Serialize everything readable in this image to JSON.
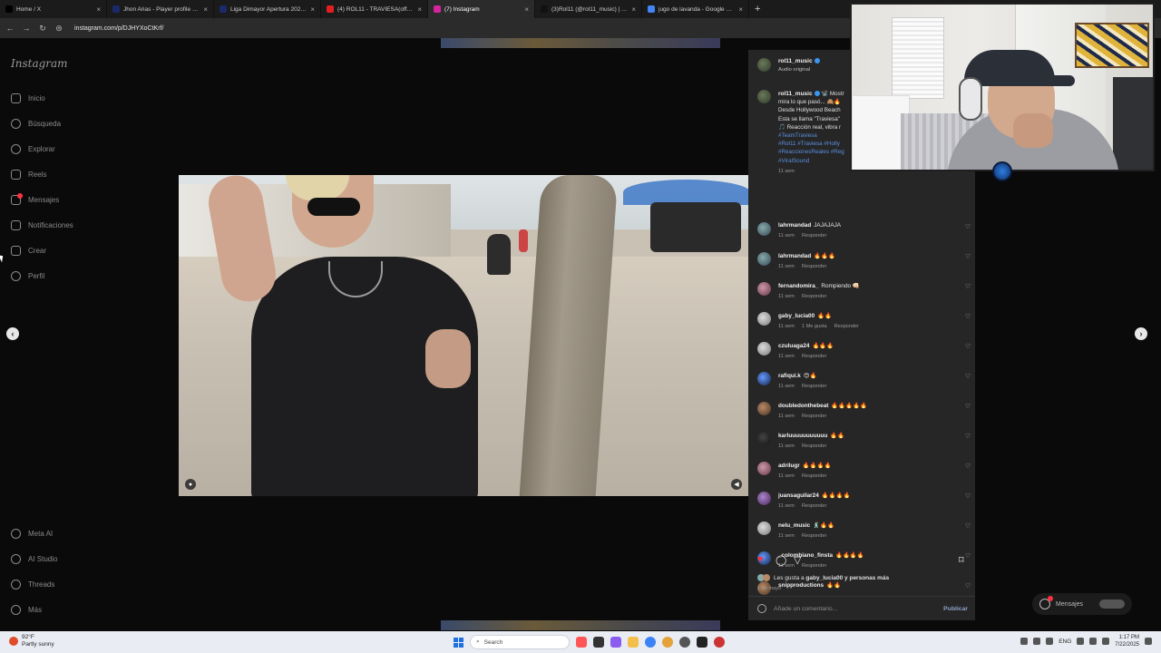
{
  "browser": {
    "tabs": [
      {
        "label": "Home / X",
        "icon": "x-logo-icon",
        "color": "#000000",
        "active": false
      },
      {
        "label": "Jhon Arias - Player profile 25/26",
        "icon": "site-icon",
        "color": "#1a2a6a",
        "active": false
      },
      {
        "label": "Liga Dimayor Apertura 2025 | Tr",
        "icon": "site-icon",
        "color": "#1a2a6a",
        "active": false
      },
      {
        "label": "(4) ROL11 - TRAVIESA(official vi",
        "icon": "youtube-icon",
        "color": "#e02020",
        "active": false
      },
      {
        "label": "(7) Instagram",
        "icon": "instagram-icon",
        "color": "#d6249f",
        "active": true
      },
      {
        "label": "(3)Rol11 (@rol11_music) | TikTok",
        "icon": "tiktok-icon",
        "color": "#111111",
        "active": false
      },
      {
        "label": "jugo de lavanda - Google Search",
        "icon": "google-icon",
        "color": "#4285f4",
        "active": false
      }
    ],
    "new_tab": "+",
    "url": "instagram.com/p/DJHYXoCtKrf/"
  },
  "sidebar": {
    "logo": "Instagram",
    "top_items": [
      {
        "label": "Inicio",
        "icon": "home-icon"
      },
      {
        "label": "Búsqueda",
        "icon": "search-icon"
      },
      {
        "label": "Explorar",
        "icon": "compass-icon"
      },
      {
        "label": "Reels",
        "icon": "reels-icon"
      },
      {
        "label": "Mensajes",
        "icon": "messenger-icon"
      },
      {
        "label": "Notificaciones",
        "icon": "heart-icon"
      },
      {
        "label": "Crear",
        "icon": "plus-square-icon"
      },
      {
        "label": "Perfil",
        "icon": "profile-avatar-icon"
      }
    ],
    "bottom_items": [
      {
        "label": "Meta AI",
        "icon": "meta-ai-icon"
      },
      {
        "label": "AI Studio",
        "icon": "ai-studio-icon"
      },
      {
        "label": "Threads",
        "icon": "threads-icon"
      },
      {
        "label": "Más",
        "icon": "menu-icon"
      }
    ]
  },
  "post": {
    "username": "rol11_music",
    "audio": "Audio original",
    "caption_lines": [
      "📽️ Mostr",
      "mira lo que pasó... 🙈🔥",
      "Desde Hollywood Beach",
      "Esta se llama \"Traviesa\"",
      "🎵 Reacción real, vibra r"
    ],
    "hashtags": [
      "#TeamTraviesa",
      "#Rol11 #Traviesa #Holly",
      "#ReaccionesReales #Reg",
      "#ViralSound"
    ],
    "caption_time": "11 sem",
    "comments": [
      {
        "user": "lahrmandad",
        "text": "JAJAJAJA",
        "time": "11 sem",
        "likes": "",
        "reply": "Responder"
      },
      {
        "user": "lahrmandad",
        "text": "🔥🔥🔥",
        "time": "11 sem",
        "likes": "",
        "reply": "Responder"
      },
      {
        "user": "fernandomira_",
        "text": "Rompiendo 👊🏻",
        "time": "11 sem",
        "likes": "",
        "reply": "Responder"
      },
      {
        "user": "gaby_lucia00",
        "text": "🔥🔥",
        "time": "11 sem",
        "likes": "1 Me gusta",
        "reply": "Responder"
      },
      {
        "user": "czuluaga24",
        "text": "🔥🔥🔥",
        "time": "11 sem",
        "likes": "",
        "reply": "Responder"
      },
      {
        "user": "rafiqui.k",
        "text": "😍🔥",
        "time": "11 sem",
        "likes": "",
        "reply": "Responder"
      },
      {
        "user": "doubledonthebeat",
        "text": "🔥🔥🔥🔥🔥",
        "time": "11 sem",
        "likes": "",
        "reply": "Responder"
      },
      {
        "user": "karluuuuuuuuuuu",
        "text": "🔥🔥",
        "time": "11 sem",
        "likes": "",
        "reply": "Responder"
      },
      {
        "user": "adrilugr",
        "text": "🔥🔥🔥🔥",
        "time": "11 sem",
        "likes": "",
        "reply": "Responder"
      },
      {
        "user": "juansaguilar24",
        "text": "🔥🔥🔥🔥",
        "time": "11 sem",
        "likes": "",
        "reply": "Responder"
      },
      {
        "user": "nelu_music",
        "text": "🕺🔥🔥",
        "time": "11 sem",
        "likes": "",
        "reply": "Responder"
      },
      {
        "user": "_colombiano_finsta",
        "text": "🔥🔥🔥🔥",
        "time": "11 sem",
        "likes": "",
        "reply": "Responder"
      },
      {
        "user": "snipproductions",
        "text": "🔥🔥",
        "time": "",
        "likes": "",
        "reply": ""
      }
    ],
    "liked_by": "Les gusta a ",
    "liked_user": "gaby_lucia00",
    "liked_rest": " y personas más",
    "date": "1 de mayo",
    "add_comment_placeholder": "Añade un comentario...",
    "publish": "Publicar"
  },
  "floating_messages": "Mensajes",
  "taskbar": {
    "temperature": "92°F",
    "weather": "Partly sunny",
    "search": "Search",
    "lang": "ENG",
    "time": "1:17 PM",
    "date": "7/22/2025"
  },
  "colors": {
    "accent_like": "#ff3040",
    "link": "#5b8fe0",
    "panel": "#262626"
  }
}
